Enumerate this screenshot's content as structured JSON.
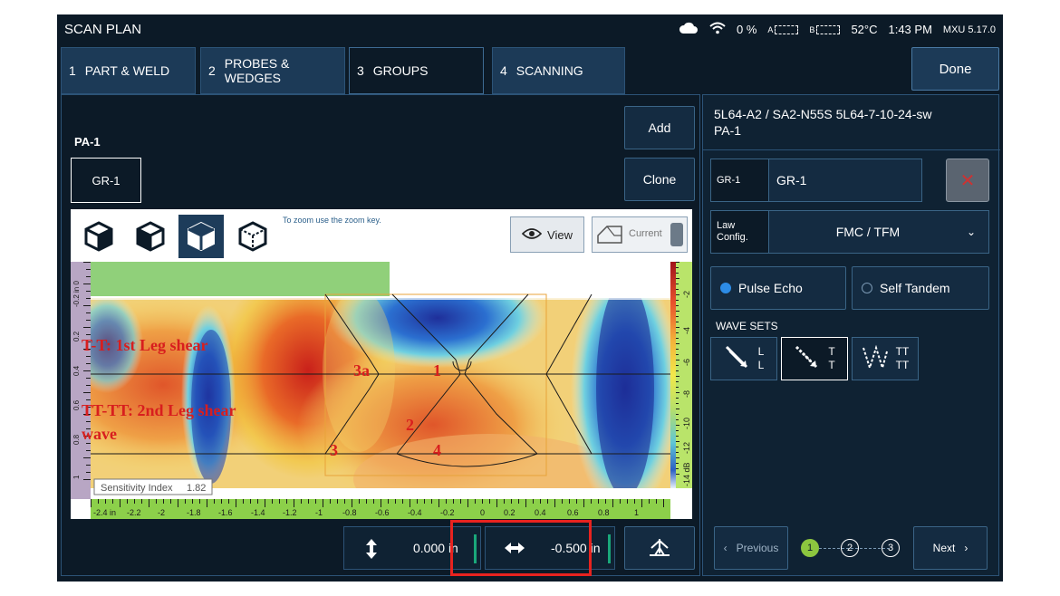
{
  "app": {
    "title": "SCAN PLAN",
    "battery": "0 %",
    "drive_a": "A",
    "drive_b": "B",
    "temperature": "52°C",
    "time": "1:43 PM",
    "version": "MXU  5.17.0"
  },
  "tabs": [
    {
      "num": "1",
      "label": "PART & WELD"
    },
    {
      "num": "2",
      "label": "PROBES & WEDGES"
    },
    {
      "num": "3",
      "label": "GROUPS"
    },
    {
      "num": "4",
      "label": "SCANNING"
    }
  ],
  "done_label": "Done",
  "left": {
    "pa_label": "PA-1",
    "group_button": "GR-1",
    "add_label": "Add",
    "clone_label": "Clone",
    "zoom_hint": "To zoom use the zoom key.",
    "view_label": "View",
    "current_label": "Current",
    "sensitivity_label": "Sensitivity Index",
    "sensitivity_value": "1.82",
    "annotation_tt": "T-T: 1st Leg shear",
    "annotation_tttt_1": "TT-TT: 2nd Leg shear",
    "annotation_tttt_2": "wave",
    "zone_labels": [
      "3a",
      "1",
      "2",
      "3",
      "4"
    ],
    "x_ticks": [
      "-2.4 in",
      "-2.2",
      "-2",
      "-1.8",
      "-1.6",
      "-1.4",
      "-1.2",
      "-1",
      "-0.8",
      "-0.6",
      "-0.4",
      "-0.2",
      "0",
      "0.2",
      "0.4",
      "0.6",
      "0.8",
      "1"
    ],
    "y_ticks": [
      "-0.2 in 0",
      "0.2",
      "0.4",
      "0.6",
      "0.8",
      "1"
    ],
    "color_ticks": [
      "-2",
      "-4",
      "-6",
      "-8",
      "-10",
      "-12",
      "-14 dB"
    ],
    "vertical_offset": "0.000",
    "horizontal_offset": "-0.500",
    "unit_suffix": "in"
  },
  "right": {
    "title_line1": "5L64-A2 / SA2-N55S 5L64-7-10-24-sw",
    "title_line2": "PA-1",
    "group_small": "GR-1",
    "group_name": "GR-1",
    "law_label": "Law Config.",
    "law_value": "FMC / TFM",
    "pulse_echo": "Pulse Echo",
    "self_tandem": "Self Tandem",
    "wave_sets_label": "WAVE SETS",
    "wave_sets": [
      {
        "a": "L",
        "b": "L"
      },
      {
        "a": "T",
        "b": "T"
      },
      {
        "a": "TT",
        "b": "TT"
      }
    ],
    "previous_label": "Previous",
    "next_label": "Next",
    "steps": [
      "1",
      "2",
      "3"
    ]
  },
  "colors": {
    "accent_green": "#8cc63f",
    "highlight_red": "#e8231f",
    "panel_blue": "#1c3a57"
  }
}
